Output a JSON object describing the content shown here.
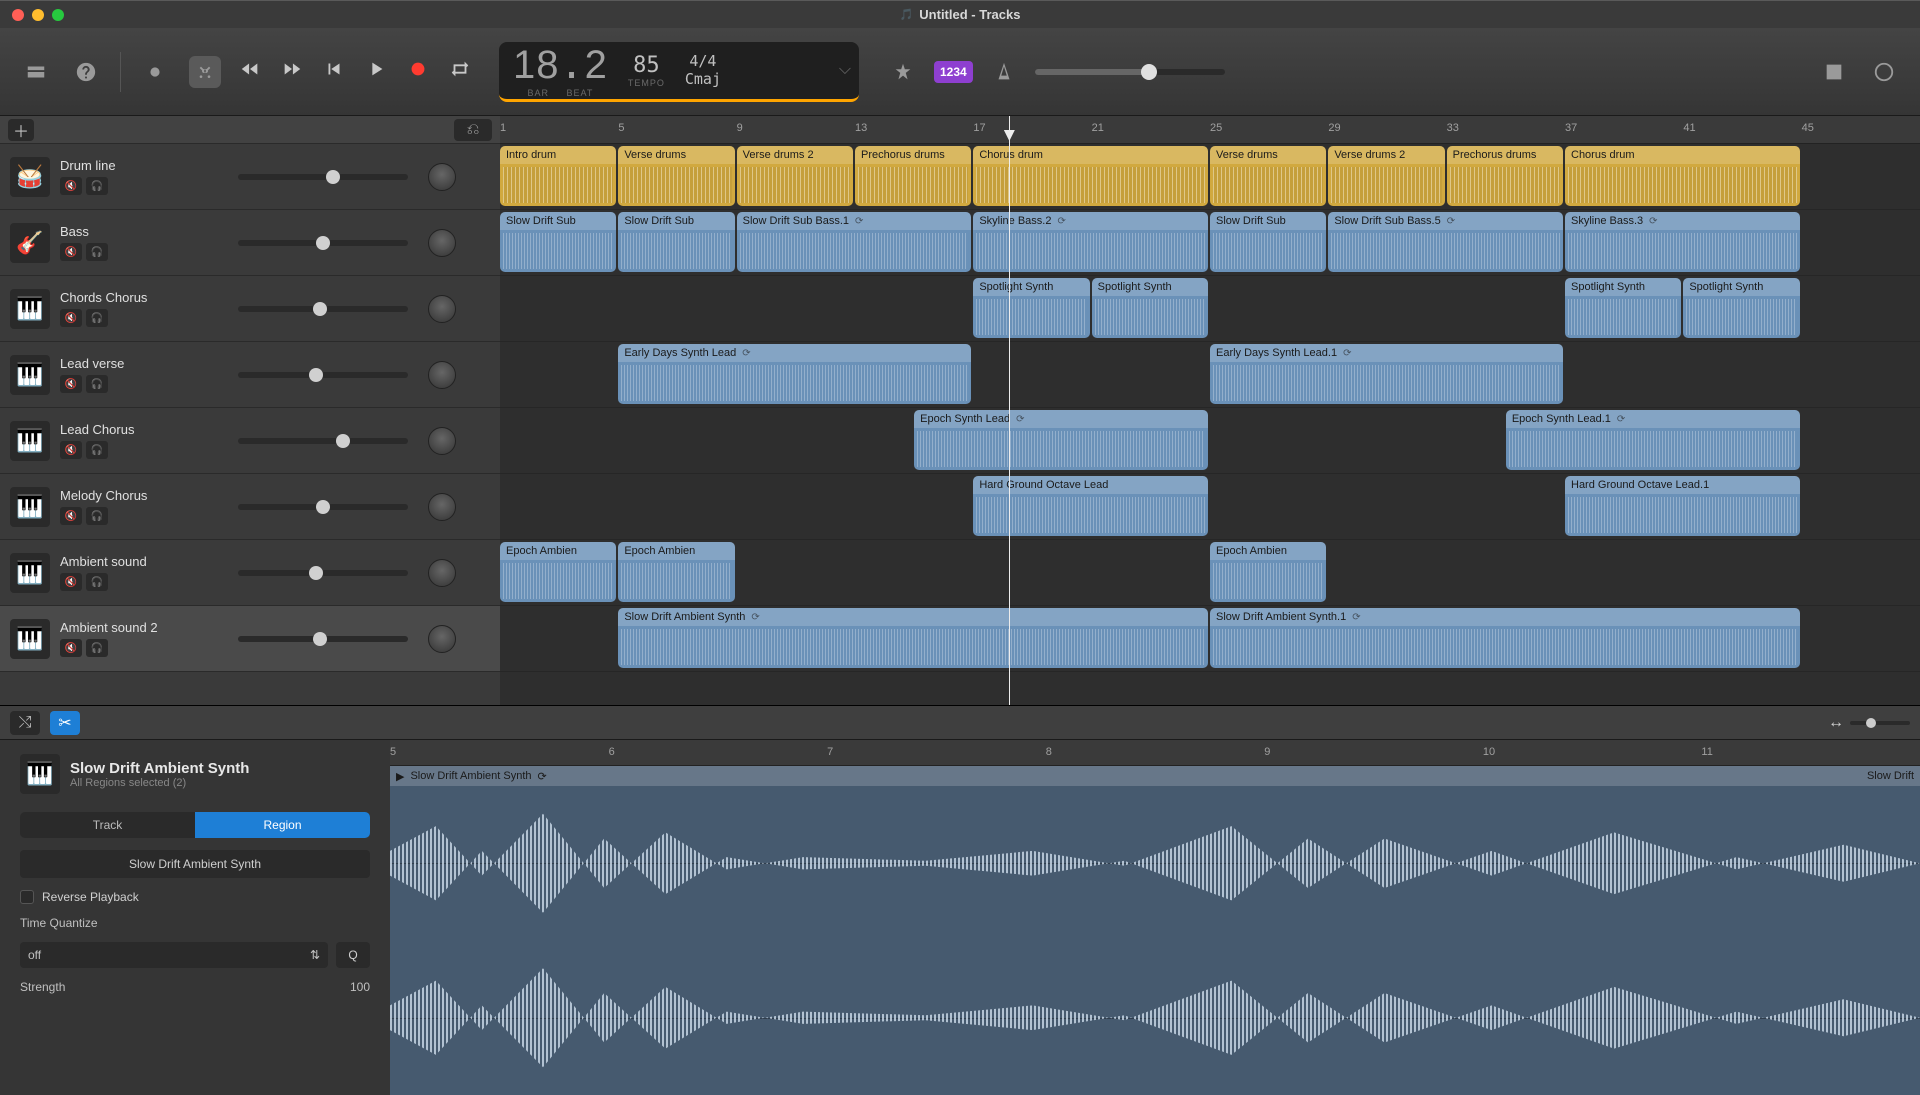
{
  "window": {
    "title": "Untitled - Tracks"
  },
  "lcd": {
    "bar": "18",
    "beat": "2",
    "tempo": "85",
    "sig": "4/4",
    "key": "Cmaj",
    "bar_label": "BAR",
    "beat_label": "BEAT",
    "tempo_label": "TEMPO"
  },
  "count_in": "1234",
  "ruler_marks": [
    "1",
    "5",
    "9",
    "13",
    "17",
    "21",
    "25",
    "29",
    "33",
    "37",
    "41",
    "45"
  ],
  "playhead_bar": 18.2,
  "tracks": [
    {
      "name": "Drum line",
      "icon": "🥁",
      "vol": 0.56
    },
    {
      "name": "Bass",
      "icon": "🎸",
      "vol": 0.5
    },
    {
      "name": "Chords Chorus",
      "icon": "🎹",
      "vol": 0.48
    },
    {
      "name": "Lead verse",
      "icon": "🎹",
      "vol": 0.46
    },
    {
      "name": "Lead Chorus",
      "icon": "🎹",
      "vol": 0.62
    },
    {
      "name": "Melody Chorus",
      "icon": "🎹",
      "vol": 0.5
    },
    {
      "name": "Ambient sound",
      "icon": "🎹",
      "vol": 0.46
    },
    {
      "name": "Ambient sound 2",
      "icon": "🎹",
      "vol": 0.48,
      "selected": true
    }
  ],
  "regions": [
    [
      {
        "label": "Intro drum",
        "start": 1,
        "end": 5,
        "color": "yellow"
      },
      {
        "label": "Verse drums",
        "start": 5,
        "end": 9,
        "color": "yellow"
      },
      {
        "label": "Verse drums 2",
        "start": 9,
        "end": 13,
        "color": "yellow"
      },
      {
        "label": "Prechorus drums",
        "start": 13,
        "end": 17,
        "color": "yellow"
      },
      {
        "label": "Chorus drum",
        "start": 17,
        "end": 25,
        "color": "yellow"
      },
      {
        "label": "Verse drums",
        "start": 25,
        "end": 29,
        "color": "yellow"
      },
      {
        "label": "Verse drums 2",
        "start": 29,
        "end": 33,
        "color": "yellow"
      },
      {
        "label": "Prechorus drums",
        "start": 33,
        "end": 37,
        "color": "yellow"
      },
      {
        "label": "Chorus drum",
        "start": 37,
        "end": 45,
        "color": "yellow"
      }
    ],
    [
      {
        "label": "Slow Drift Sub",
        "start": 1,
        "end": 5,
        "color": "blue"
      },
      {
        "label": "Slow Drift Sub",
        "start": 5,
        "end": 9,
        "color": "blue"
      },
      {
        "label": "Slow Drift Sub Bass.1",
        "start": 9,
        "end": 17,
        "color": "blue",
        "loop": true
      },
      {
        "label": "Skyline Bass.2",
        "start": 17,
        "end": 25,
        "color": "blue",
        "loop": true
      },
      {
        "label": "Slow Drift Sub",
        "start": 25,
        "end": 29,
        "color": "blue"
      },
      {
        "label": "Slow Drift Sub Bass.5",
        "start": 29,
        "end": 37,
        "color": "blue",
        "loop": true
      },
      {
        "label": "Skyline Bass.3",
        "start": 37,
        "end": 45,
        "color": "blue",
        "loop": true
      }
    ],
    [
      {
        "label": "Spotlight Synth",
        "start": 17,
        "end": 21,
        "color": "blue"
      },
      {
        "label": "Spotlight Synth",
        "start": 21,
        "end": 25,
        "color": "blue"
      },
      {
        "label": "Spotlight Synth",
        "start": 37,
        "end": 41,
        "color": "blue"
      },
      {
        "label": "Spotlight Synth",
        "start": 41,
        "end": 45,
        "color": "blue"
      }
    ],
    [
      {
        "label": "Early Days Synth Lead",
        "start": 5,
        "end": 17,
        "color": "blue",
        "loop": true
      },
      {
        "label": "Early Days Synth Lead.1",
        "start": 25,
        "end": 37,
        "color": "blue",
        "loop": true
      }
    ],
    [
      {
        "label": "Epoch Synth Lead",
        "start": 15,
        "end": 25,
        "color": "blue",
        "loop": true
      },
      {
        "label": "Epoch Synth Lead.1",
        "start": 35,
        "end": 45,
        "color": "blue",
        "loop": true
      }
    ],
    [
      {
        "label": "Hard Ground Octave Lead",
        "start": 17,
        "end": 25,
        "color": "blue"
      },
      {
        "label": "Hard Ground Octave Lead.1",
        "start": 37,
        "end": 45,
        "color": "blue"
      }
    ],
    [
      {
        "label": "Epoch Ambien",
        "start": 1,
        "end": 5,
        "color": "blue"
      },
      {
        "label": "Epoch Ambien",
        "start": 5,
        "end": 9,
        "color": "blue"
      },
      {
        "label": "Epoch Ambien",
        "start": 25,
        "end": 29,
        "color": "blue"
      }
    ],
    [
      {
        "label": "Slow Drift Ambient Synth",
        "start": 5,
        "end": 25,
        "color": "blue",
        "loop": true
      },
      {
        "label": "Slow Drift Ambient Synth.1",
        "start": 25,
        "end": 45,
        "color": "blue",
        "loop": true
      }
    ]
  ],
  "editor": {
    "title": "Slow Drift Ambient Synth",
    "sub": "All Regions selected (2)",
    "tabs": {
      "track": "Track",
      "region": "Region",
      "active": "region"
    },
    "region_name": "Slow Drift Ambient Synth",
    "reverse_label": "Reverse Playback",
    "quantize_label": "Time Quantize",
    "quantize_value": "off",
    "q_button": "Q",
    "strength_label": "Strength",
    "strength_value": "100",
    "ruler_marks": [
      "5",
      "6",
      "7",
      "8",
      "9",
      "10",
      "11"
    ],
    "clip_label": "Slow Drift Ambient Synth",
    "clip2_label": "Slow Drift",
    "scale": {
      "p100": "100",
      "zero": "0",
      "n100": "-100"
    }
  }
}
